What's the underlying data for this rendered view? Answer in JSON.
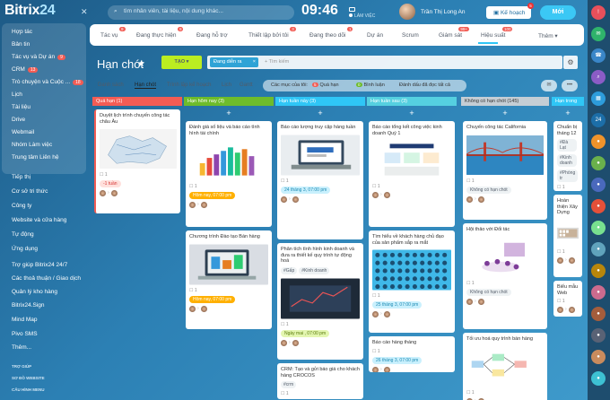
{
  "header": {
    "logo_text": "Bitrix",
    "logo_num": "24",
    "search_placeholder": "tìm nhân viên, tài liệu, nội dung khác...",
    "time": "09:46",
    "work_status": "LÀM VIỆC",
    "user_name": "Trần Thị Long An",
    "plan_label": "Kế hoạch",
    "plan_badge": "5",
    "new_label": "Mới"
  },
  "sidebar": {
    "items": [
      {
        "label": "Hợp tác",
        "count": ""
      },
      {
        "label": "Bản tin",
        "count": ""
      },
      {
        "label": "Tác vụ và Dự án",
        "count": "9"
      },
      {
        "label": "CRM",
        "count": "13"
      },
      {
        "label": "Trò chuyện và Cuộc ...",
        "count": "18"
      },
      {
        "label": "Lịch",
        "count": ""
      },
      {
        "label": "Tài liệu",
        "count": ""
      },
      {
        "label": "Drive",
        "count": ""
      },
      {
        "label": "Webmail",
        "count": ""
      },
      {
        "label": "Nhóm Làm việc",
        "count": ""
      },
      {
        "label": "Trung tâm Liên hệ",
        "count": ""
      },
      {
        "label": "Tiếp thị",
        "count": ""
      },
      {
        "label": "Cơ sở tri thức",
        "count": ""
      },
      {
        "label": "Công ty",
        "count": ""
      },
      {
        "label": "Website và cửa hàng",
        "count": ""
      },
      {
        "label": "Tự động",
        "count": ""
      },
      {
        "label": "Ứng dụng",
        "count": ""
      },
      {
        "label": "Trợ giúp Bitrix24 24/7",
        "count": ""
      },
      {
        "label": "Các thoả thuận / Giao dịch",
        "count": ""
      },
      {
        "label": "Quản lý kho hàng",
        "count": ""
      },
      {
        "label": "Bitrix24.Sign",
        "count": ""
      },
      {
        "label": "Mind Map",
        "count": ""
      },
      {
        "label": "Pivo SMS",
        "count": ""
      },
      {
        "label": "Thêm...",
        "count": ""
      }
    ],
    "footer": [
      "TRỢ GIÚP",
      "SƠ ĐỒ WEBSITE",
      "CẤU HÌNH MENU"
    ]
  },
  "tabs": [
    {
      "label": "Tác vụ",
      "badge": "9"
    },
    {
      "label": "Đang thực hiện",
      "badge": "9"
    },
    {
      "label": "Đang hỗ trợ",
      "badge": ""
    },
    {
      "label": "Thiết lập bởi tôi",
      "badge": "3"
    },
    {
      "label": "Đang theo dõi",
      "badge": "1"
    },
    {
      "label": "Dự án",
      "badge": ""
    },
    {
      "label": "Scrum",
      "badge": ""
    },
    {
      "label": "Giám sát",
      "badge": "99+"
    },
    {
      "label": "Hiệu suất",
      "badge": "100"
    },
    {
      "label": "Thêm",
      "badge": ""
    }
  ],
  "page": {
    "title": "Hạn chót",
    "create_label": "TẠO",
    "filter_chip": "Đang diễn ra",
    "search_placeholder": "+ Tìm kiếm"
  },
  "views": [
    "Danh sách",
    "Hạn chót",
    "Trình lập kế hoạch",
    "Lịch",
    "Gantt"
  ],
  "counters": {
    "label": "Các mục của tôi:",
    "items": [
      {
        "n": "5",
        "label": "Quá hạn"
      },
      {
        "n": "0",
        "label": "Bình luận"
      },
      {
        "n": "",
        "label": "Đánh dấu đã đọc tất cả"
      }
    ]
  },
  "columns": [
    {
      "title": "Quá hạn (1)",
      "color": "#f25c54",
      "cards": [
        {
          "title": "Duyệt lịch trình chuyến công tác châu Âu",
          "deadline": "-1 tuần",
          "dcolor": "#ffe0dc",
          "dtext": "#d63939",
          "img": "map"
        }
      ]
    },
    {
      "title": "Hạn hôm nay (3)",
      "color": "#6ebc2b",
      "cards": [
        {
          "title": "Đánh giá số liệu và báo cáo tình hình tài chính",
          "deadline": "Hôm nay, 07:00 pm",
          "dcolor": "#ffb000",
          "dtext": "#fff",
          "img": "bars"
        },
        {
          "title": "Chương trình Đào tạo Bán hàng",
          "deadline": "Hôm nay, 07:00 pm",
          "dcolor": "#ffb000",
          "dtext": "#fff",
          "img": "laptop"
        }
      ]
    },
    {
      "title": "Hạn tuần này (3)",
      "color": "#2fc6f6",
      "cards": [
        {
          "title": "Báo cáo lượng truy cập hàng tuần",
          "deadline": "24 tháng 3, 07:00 pm",
          "dcolor": "#c9f0fd",
          "dtext": "#1e8ab3",
          "img": "laptop2"
        },
        {
          "title": "Phân tích tình hình kinh doanh và đưa ra thiết kế quy trình tự động hoá",
          "deadline": "Ngày mai , 07:00 pm",
          "dcolor": "#e3f6b0",
          "dtext": "#5a7a0b",
          "tags": [
            "#Gấp",
            "#Kinh doanh"
          ],
          "img": "dark"
        },
        {
          "title": "CRM: Tạo và gửi báo giá cho khách hàng CROCOS",
          "deadline": "",
          "tags": [
            "#crm"
          ],
          "img": ""
        }
      ]
    },
    {
      "title": "Hạn tuần sau (3)",
      "color": "#55d0e0",
      "cards": [
        {
          "title": "Báo cáo tổng kết công việc kinh doanh Quý 1",
          "deadline": "",
          "img": "report"
        },
        {
          "title": "Tìm hiểu về khách hàng chủ đạo của sản phẩm sắp ra mắt",
          "deadline": "25 tháng 3, 07:00 pm",
          "dcolor": "#c9f0fd",
          "dtext": "#1e8ab3",
          "img": "people"
        },
        {
          "title": "Báo cáo hàng tháng",
          "deadline": "26 tháng 3, 07:00 pm",
          "dcolor": "#c9f0fd",
          "dtext": "#1e8ab3",
          "img": ""
        }
      ]
    },
    {
      "title": "Không có hạn chót (145)",
      "color": "#c5ced5",
      "cards": [
        {
          "title": "Chuyến công tác California",
          "deadline": "Không có hạn chót",
          "dcolor": "#eef2f4",
          "dtext": "#535c69",
          "img": "bridge"
        },
        {
          "title": "Hội thảo với Đối tác",
          "deadline": "Không có hạn chót",
          "dcolor": "#eef2f4",
          "dtext": "#535c69",
          "img": "meeting"
        },
        {
          "title": "Tối ưu hoá quy trình bán hàng",
          "deadline": "",
          "img": "flow"
        }
      ]
    },
    {
      "title": "Hạn trong",
      "color": "#2fc6f6",
      "cards": [
        {
          "title": "Chuẩn bị tháng 12",
          "deadline": "",
          "tags": [
            "#Đà Lạt",
            "#Kinh doanh",
            "#Phòng tr"
          ],
          "img": ""
        },
        {
          "title": "Hoàn thiện Xây Dựng",
          "deadline": "",
          "img": "shelf"
        },
        {
          "title": "Biểu mẫu Web",
          "deadline": "",
          "img": ""
        }
      ]
    }
  ]
}
